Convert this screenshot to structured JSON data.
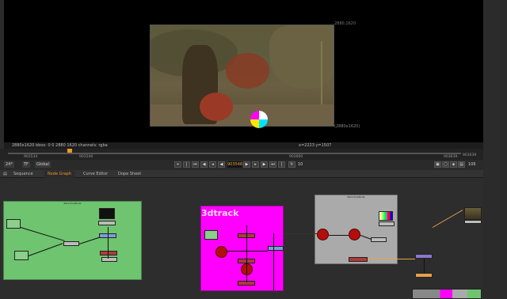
{
  "viewer": {
    "res_top_right": "2880,1620",
    "res_bottom_right": "(2880x1620)"
  },
  "info": {
    "left": "2880x1620  bbox: 0 0 2880 1620 channels: rgba",
    "coords": "x=2223 y=1507"
  },
  "timeline": {
    "start_label": "903534",
    "marker_label": "903546",
    "mid_labels": [
      "903600",
      "903620"
    ],
    "end_label": "903639",
    "far_end_label": "903639"
  },
  "controls": {
    "fps": "24*",
    "format": "TF",
    "scope": "Global",
    "current_frame": "903546",
    "step": "10",
    "end_value": "106"
  },
  "tabs": [
    {
      "label": "Sequence"
    },
    {
      "label": "Node Graph"
    },
    {
      "label": "Curve Editor"
    },
    {
      "label": "Dope Sheet"
    }
  ],
  "graph": {
    "backdrop_big_title": "3dtrack",
    "backdrop_small_title": "BackdropNode"
  },
  "colors": {
    "accent": "#f29b2a",
    "green_backdrop": "#6fc46f",
    "magenta_backdrop": "#ff00ff",
    "gray_backdrop": "#aaaaaa"
  }
}
